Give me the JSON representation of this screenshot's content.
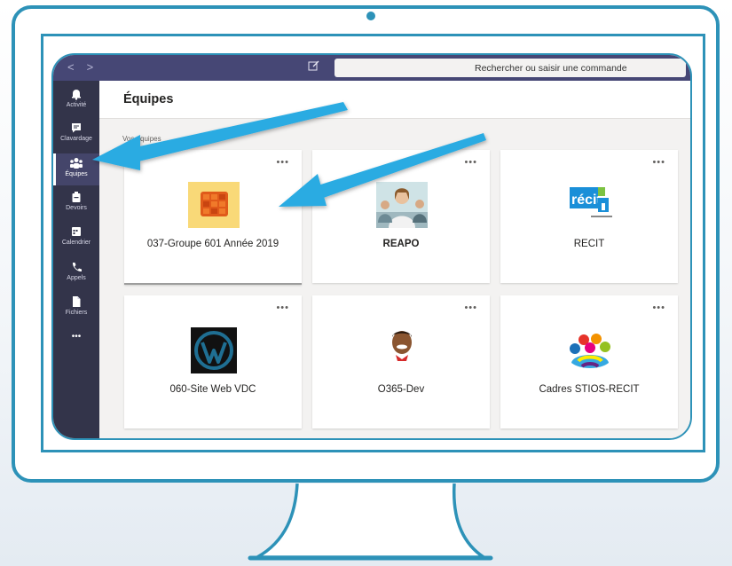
{
  "search": {
    "placeholder": "Rechercher ou saisir une commande"
  },
  "rail": {
    "items": [
      {
        "label": "Activité",
        "icon": "bell-icon"
      },
      {
        "label": "Clavardage",
        "icon": "chat-icon"
      },
      {
        "label": "Équipes",
        "icon": "teams-icon",
        "active": true
      },
      {
        "label": "Devoirs",
        "icon": "assignments-icon"
      },
      {
        "label": "Calendrier",
        "icon": "calendar-icon"
      },
      {
        "label": "Appels",
        "icon": "phone-icon"
      },
      {
        "label": "Fichiers",
        "icon": "files-icon"
      },
      {
        "label": "•••",
        "icon": "more-icon"
      }
    ]
  },
  "header": {
    "title": "Équipes"
  },
  "section": {
    "label": "Vos équipes"
  },
  "teams": [
    {
      "name": "037-Groupe 601 Année 2019",
      "icon": "orange-grid-logo"
    },
    {
      "name": "REAPO",
      "icon": "people-photo-logo"
    },
    {
      "name": "RECIT",
      "icon": "recit-logo"
    },
    {
      "name": "060-Site Web VDC",
      "icon": "wordpress-logo"
    },
    {
      "name": "O365-Dev",
      "icon": "cartoon-avatar-logo"
    },
    {
      "name": "Cadres STIOS-RECIT",
      "icon": "colorful-people-logo"
    }
  ],
  "card_more": "•••",
  "colors": {
    "frame": "#2d92b8",
    "titlebar": "#464775",
    "rail": "#33344a",
    "arrow": "#29abe2"
  }
}
